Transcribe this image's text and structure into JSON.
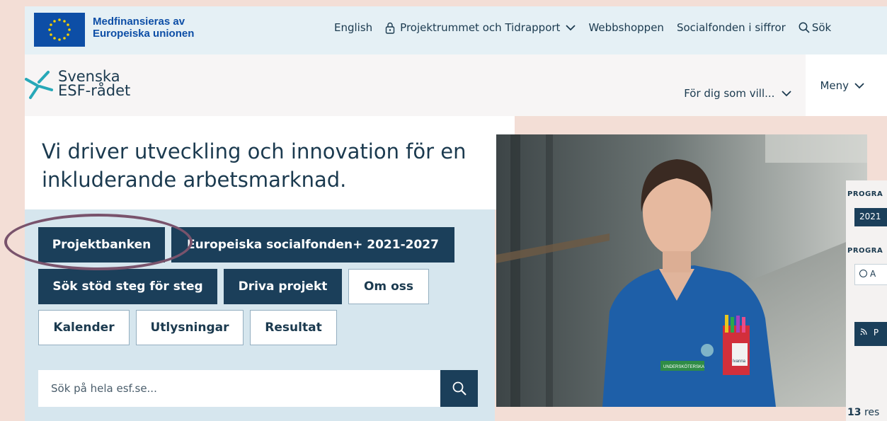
{
  "eu_bar": {
    "funding_line1": "Medfinansieras av",
    "funding_line2": "Europeiska unionen",
    "nav": {
      "english": "English",
      "projektrummet": "Projektrummet och Tidrapport",
      "webbshoppen": "Webbshoppen",
      "socialfonden": "Socialfonden i siffror",
      "search": "Sök"
    }
  },
  "header": {
    "logo_line1": "Svenska",
    "logo_line2": "ESF-rådet",
    "for_dig": "För dig som vill...",
    "meny": "Meny"
  },
  "hero": {
    "title": "Vi driver utveckling och innovation för en inkluderande arbetsmarknad.",
    "buttons": {
      "projektbanken": "Projektbanken",
      "europeiska": "Europeiska socialfonden+ 2021-2027",
      "sok_stod": "Sök stöd steg för steg",
      "driva": "Driva projekt",
      "om_oss": "Om oss",
      "kalender": "Kalender",
      "utlysningar": "Utlysningar",
      "resultat": "Resultat"
    },
    "search_placeholder": "Sök på hela esf.se..."
  },
  "photo": {
    "badge_text": "UNDERSKÖTERSKA",
    "name_tag": "Ivanna"
  },
  "side_panel": {
    "label1": "PROGRA",
    "chip": "2021",
    "label2": "PROGRA",
    "radio": "A",
    "rss": "P",
    "results_count": "13",
    "results_suffix": "res"
  },
  "colors": {
    "navy": "#1b3f5a",
    "eu_blue": "#0d4ea6",
    "panel_blue": "#d6e6ee",
    "highlight_oval": "#79536c",
    "logo_teal": "#27a8b8"
  }
}
